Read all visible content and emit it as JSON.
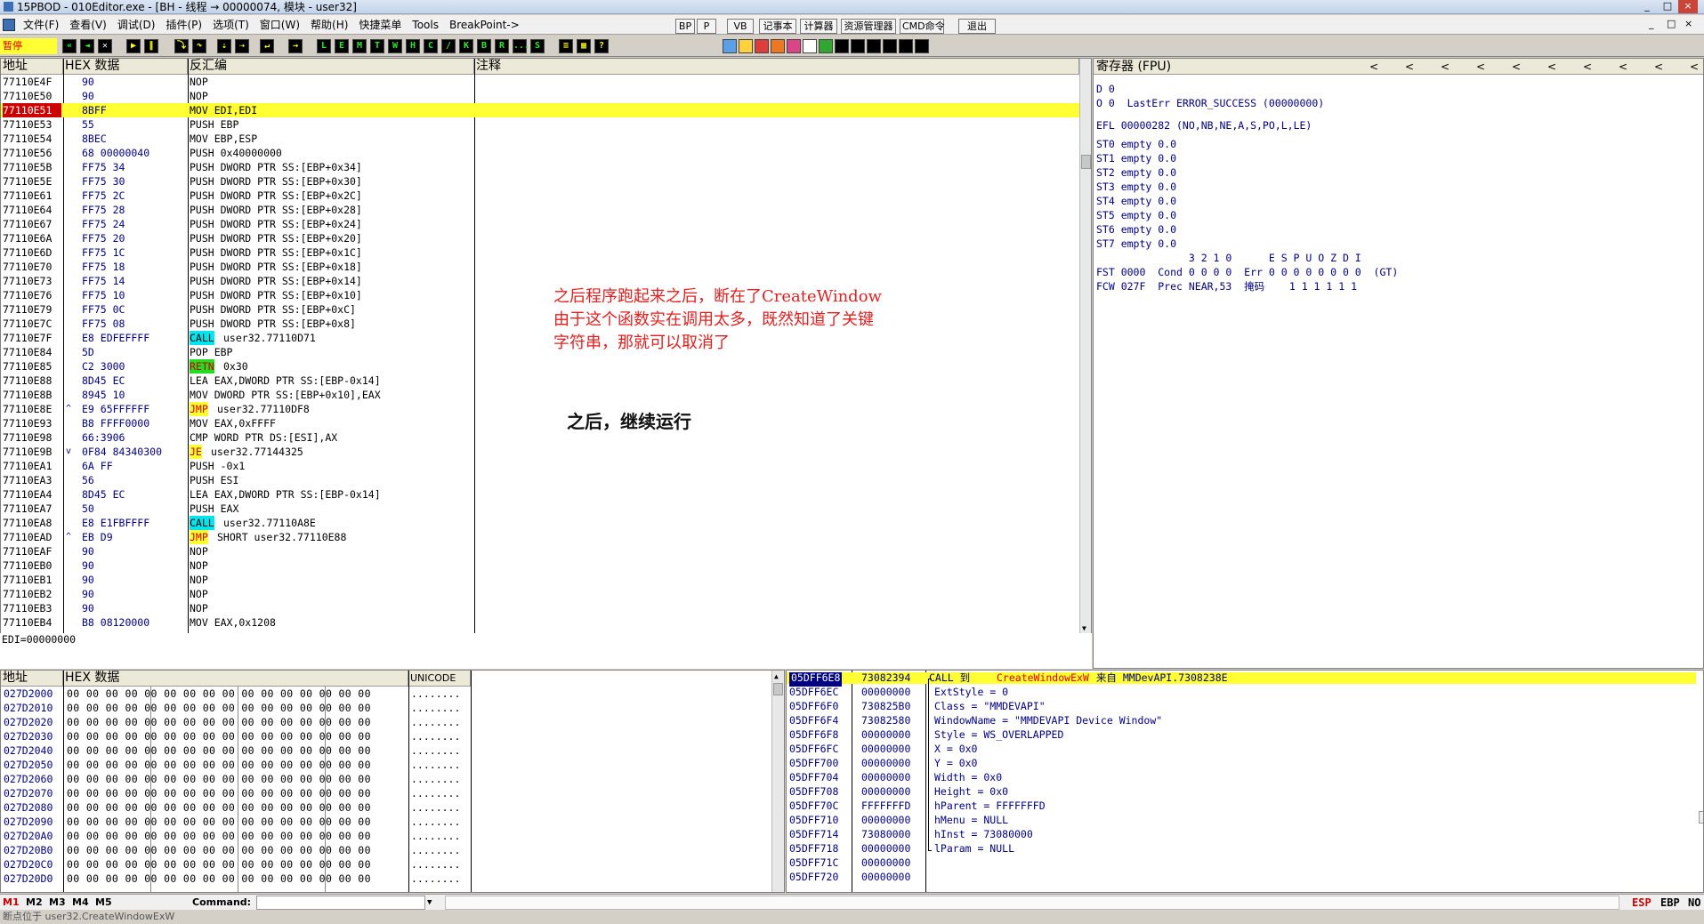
{
  "window": {
    "title": "15PBOD - 010Editor.exe - [BH - 线程 → 00000074, 模块 - user32]",
    "controls": [
      "_",
      "□",
      "×"
    ],
    "inner_controls": [
      "_",
      "□",
      "×"
    ]
  },
  "menu": [
    "文件(F)",
    "查看(V)",
    "调试(D)",
    "插件(P)",
    "选项(T)",
    "窗口(W)",
    "帮助(H)",
    "快捷菜单",
    "Tools",
    "BreakPoint->"
  ],
  "menu_buttons": [
    "BP",
    "P",
    "VB",
    "记事本",
    "计算器",
    "资源管理器",
    "CMD命令",
    "退出"
  ],
  "toolbar": {
    "status_label": "暂停",
    "letters": [
      "L",
      "E",
      "M",
      "T",
      "W",
      "H",
      "C",
      "/",
      "K",
      "B",
      "R",
      "...",
      "S"
    ]
  },
  "disasm": {
    "headers": {
      "addr": "地址",
      "hex": "HEX 数据",
      "disasm": "反汇编",
      "comment": "注释"
    },
    "rows": [
      {
        "addr": "77110E4F",
        "hex": "90",
        "asm": "NOP"
      },
      {
        "addr": "77110E50",
        "hex": "90",
        "asm": "NOP"
      },
      {
        "addr": "77110E51",
        "hex": "8BFF",
        "asm": "MOV EDI,EDI",
        "current": true
      },
      {
        "addr": "77110E53",
        "hex": "55",
        "asm": "PUSH EBP"
      },
      {
        "addr": "77110E54",
        "hex": "8BEC",
        "asm": "MOV EBP,ESP"
      },
      {
        "addr": "77110E56",
        "hex": "68 00000040",
        "asm": "PUSH 0x40000000"
      },
      {
        "addr": "77110E5B",
        "hex": "FF75 34",
        "asm": "PUSH DWORD PTR SS:[EBP+0x34]"
      },
      {
        "addr": "77110E5E",
        "hex": "FF75 30",
        "asm": "PUSH DWORD PTR SS:[EBP+0x30]"
      },
      {
        "addr": "77110E61",
        "hex": "FF75 2C",
        "asm": "PUSH DWORD PTR SS:[EBP+0x2C]"
      },
      {
        "addr": "77110E64",
        "hex": "FF75 28",
        "asm": "PUSH DWORD PTR SS:[EBP+0x28]"
      },
      {
        "addr": "77110E67",
        "hex": "FF75 24",
        "asm": "PUSH DWORD PTR SS:[EBP+0x24]"
      },
      {
        "addr": "77110E6A",
        "hex": "FF75 20",
        "asm": "PUSH DWORD PTR SS:[EBP+0x20]"
      },
      {
        "addr": "77110E6D",
        "hex": "FF75 1C",
        "asm": "PUSH DWORD PTR SS:[EBP+0x1C]"
      },
      {
        "addr": "77110E70",
        "hex": "FF75 18",
        "asm": "PUSH DWORD PTR SS:[EBP+0x18]"
      },
      {
        "addr": "77110E73",
        "hex": "FF75 14",
        "asm": "PUSH DWORD PTR SS:[EBP+0x14]"
      },
      {
        "addr": "77110E76",
        "hex": "FF75 10",
        "asm": "PUSH DWORD PTR SS:[EBP+0x10]"
      },
      {
        "addr": "77110E79",
        "hex": "FF75 0C",
        "asm": "PUSH DWORD PTR SS:[EBP+0xC]"
      },
      {
        "addr": "77110E7C",
        "hex": "FF75 08",
        "asm": "PUSH DWORD PTR SS:[EBP+0x8]"
      },
      {
        "addr": "77110E7F",
        "hex": "E8 EDFEFFFF",
        "op": "CALL",
        "opclass": "call",
        "arg": "user32.77110D71"
      },
      {
        "addr": "77110E84",
        "hex": "5D",
        "asm": "POP EBP"
      },
      {
        "addr": "77110E85",
        "hex": "C2 3000",
        "op": "RETN",
        "opclass": "retn",
        "arg": "0x30"
      },
      {
        "addr": "77110E88",
        "hex": "8D45 EC",
        "asm": "LEA EAX,DWORD PTR SS:[EBP-0x14]"
      },
      {
        "addr": "77110E8B",
        "hex": "8945 10",
        "asm": "MOV DWORD PTR SS:[EBP+0x10],EAX"
      },
      {
        "addr": "77110E8E",
        "mark": "^",
        "hex": "E9 65FFFFFF",
        "op": "JMP",
        "opclass": "jmp",
        "arg": "user32.77110DF8"
      },
      {
        "addr": "77110E93",
        "hex": "B8 FFFF0000",
        "asm": "MOV EAX,0xFFFF"
      },
      {
        "addr": "77110E98",
        "hex": "66:3906",
        "asm": "CMP WORD PTR DS:[ESI],AX"
      },
      {
        "addr": "77110E9B",
        "mark": "v",
        "hex": "0F84 84340300",
        "op": "JE",
        "opclass": "jmp",
        "arg": "user32.77144325"
      },
      {
        "addr": "77110EA1",
        "hex": "6A FF",
        "asm": "PUSH -0x1"
      },
      {
        "addr": "77110EA3",
        "hex": "56",
        "asm": "PUSH ESI"
      },
      {
        "addr": "77110EA4",
        "hex": "8D45 EC",
        "asm": "LEA EAX,DWORD PTR SS:[EBP-0x14]"
      },
      {
        "addr": "77110EA7",
        "hex": "50",
        "asm": "PUSH EAX"
      },
      {
        "addr": "77110EA8",
        "hex": "E8 E1FBFFFF",
        "op": "CALL",
        "opclass": "call",
        "arg": "user32.77110A8E"
      },
      {
        "addr": "77110EAD",
        "mark": "^",
        "hex": "EB D9",
        "op": "JMP",
        "opclass": "jmp",
        "arg": "SHORT user32.77110E88"
      },
      {
        "addr": "77110EAF",
        "hex": "90",
        "asm": "NOP"
      },
      {
        "addr": "77110EB0",
        "hex": "90",
        "asm": "NOP"
      },
      {
        "addr": "77110EB1",
        "hex": "90",
        "asm": "NOP"
      },
      {
        "addr": "77110EB2",
        "hex": "90",
        "asm": "NOP"
      },
      {
        "addr": "77110EB3",
        "hex": "90",
        "asm": "NOP"
      },
      {
        "addr": "77110EB4",
        "hex": "B8 08120000",
        "asm": "MOV EAX,0x1208"
      }
    ],
    "info_line": "EDI=00000000"
  },
  "notes": {
    "line1": "之后程序跑起来之后，断在了CreateWindow",
    "line2": "由于这个函数实在调用太多，既然知道了关键",
    "line3": "字符串，那就可以取消了",
    "line4": "之后，继续运行"
  },
  "registers": {
    "header": "寄存器 (FPU)",
    "nav_arrows": [
      "<",
      "<",
      "<",
      "<",
      "<",
      "<",
      "<",
      "<",
      "<",
      "<"
    ],
    "lines": [
      "D 0",
      "O 0  LastErr ERROR_SUCCESS (00000000)",
      "",
      "EFL 00000282 (NO,NB,NE,A,S,PO,L,LE)",
      "",
      "ST0 empty 0.0",
      "ST1 empty 0.0",
      "ST2 empty 0.0",
      "ST3 empty 0.0",
      "ST4 empty 0.0",
      "ST5 empty 0.0",
      "ST6 empty 0.0",
      "ST7 empty 0.0",
      "               3 2 1 0      E S P U O Z D I",
      "FST 0000  Cond 0 0 0 0  Err 0 0 0 0 0 0 0 0  (GT)",
      "FCW 027F  Prec NEAR,53  掩码    1 1 1 1 1 1"
    ]
  },
  "dump": {
    "headers": {
      "addr": "地址",
      "hex": "HEX 数据",
      "unicode": "UNICODE"
    },
    "rows": [
      {
        "addr": "027D2000",
        "hex": "00 00 00 00 00 00 00 00 00 00 00 00 00 00 00 00",
        "uni": "........"
      },
      {
        "addr": "027D2010",
        "hex": "00 00 00 00 00 00 00 00 00 00 00 00 00 00 00 00",
        "uni": "........"
      },
      {
        "addr": "027D2020",
        "hex": "00 00 00 00 00 00 00 00 00 00 00 00 00 00 00 00",
        "uni": "........"
      },
      {
        "addr": "027D2030",
        "hex": "00 00 00 00 00 00 00 00 00 00 00 00 00 00 00 00",
        "uni": "........"
      },
      {
        "addr": "027D2040",
        "hex": "00 00 00 00 00 00 00 00 00 00 00 00 00 00 00 00",
        "uni": "........"
      },
      {
        "addr": "027D2050",
        "hex": "00 00 00 00 00 00 00 00 00 00 00 00 00 00 00 00",
        "uni": "........"
      },
      {
        "addr": "027D2060",
        "hex": "00 00 00 00 00 00 00 00 00 00 00 00 00 00 00 00",
        "uni": "........"
      },
      {
        "addr": "027D2070",
        "hex": "00 00 00 00 00 00 00 00 00 00 00 00 00 00 00 00",
        "uni": "........"
      },
      {
        "addr": "027D2080",
        "hex": "00 00 00 00 00 00 00 00 00 00 00 00 00 00 00 00",
        "uni": "........"
      },
      {
        "addr": "027D2090",
        "hex": "00 00 00 00 00 00 00 00 00 00 00 00 00 00 00 00",
        "uni": "........"
      },
      {
        "addr": "027D20A0",
        "hex": "00 00 00 00 00 00 00 00 00 00 00 00 00 00 00 00",
        "uni": "........"
      },
      {
        "addr": "027D20B0",
        "hex": "00 00 00 00 00 00 00 00 00 00 00 00 00 00 00 00",
        "uni": "........"
      },
      {
        "addr": "027D20C0",
        "hex": "00 00 00 00 00 00 00 00 00 00 00 00 00 00 00 00",
        "uni": "........"
      },
      {
        "addr": "027D20D0",
        "hex": "00 00 00 00 00 00 00 00 00 00 00 00 00 00 00 00",
        "uni": "........"
      }
    ]
  },
  "stack": {
    "rows": [
      {
        "addr": "05DFF6E8",
        "val": "73082394",
        "pre": "CALL 到 ",
        "func": "CreateWindowExW",
        "post": " 来自 MMDevAPI.7308238E",
        "top": true
      },
      {
        "addr": "05DFF6EC",
        "val": "00000000",
        "text": "ExtStyle = 0"
      },
      {
        "addr": "05DFF6F0",
        "val": "730825B0",
        "text": "Class = \"MMDEVAPI\""
      },
      {
        "addr": "05DFF6F4",
        "val": "73082580",
        "text": "WindowName = \"MMDEVAPI Device Window\""
      },
      {
        "addr": "05DFF6F8",
        "val": "00000000",
        "text": "Style = WS_OVERLAPPED"
      },
      {
        "addr": "05DFF6FC",
        "val": "00000000",
        "text": "X = 0x0"
      },
      {
        "addr": "05DFF700",
        "val": "00000000",
        "text": "Y = 0x0"
      },
      {
        "addr": "05DFF704",
        "val": "00000000",
        "text": "Width = 0x0"
      },
      {
        "addr": "05DFF708",
        "val": "00000000",
        "text": "Height = 0x0"
      },
      {
        "addr": "05DFF70C",
        "val": "FFFFFFFD",
        "text": "hParent = FFFFFFFD"
      },
      {
        "addr": "05DFF710",
        "val": "00000000",
        "text": "hMenu = NULL"
      },
      {
        "addr": "05DFF714",
        "val": "73080000",
        "text": "hInst = 73080000"
      },
      {
        "addr": "05DFF718",
        "val": "00000000",
        "text": "lParam = NULL"
      },
      {
        "addr": "05DFF71C",
        "val": "00000000",
        "text": ""
      },
      {
        "addr": "05DFF720",
        "val": "00000000",
        "text": ""
      }
    ]
  },
  "command_bar": {
    "tabs": [
      "M1",
      "M2",
      "M3",
      "M4",
      "M5"
    ],
    "command_label": "Command:",
    "command_value": "",
    "regs": [
      "ESP",
      "EBP",
      "NO"
    ]
  },
  "status": "断点位于 user32.CreateWindowExW"
}
